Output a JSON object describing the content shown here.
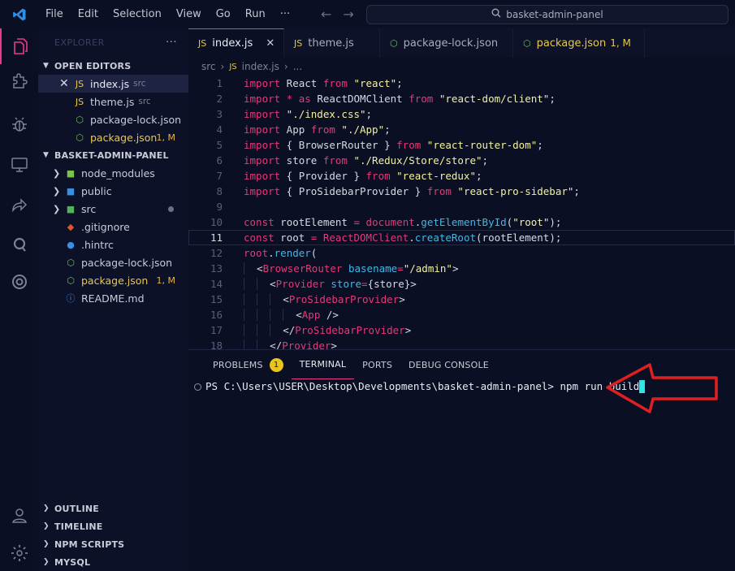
{
  "titlebar": {
    "menu": [
      "File",
      "Edit",
      "Selection",
      "View",
      "Go",
      "Run",
      "···"
    ],
    "search_text": "basket-admin-panel"
  },
  "sidebar": {
    "title": "EXPLORER",
    "more": "···",
    "open_editors_label": "OPEN EDITORS",
    "open_editors": [
      {
        "name": "index.js",
        "sub": "src",
        "icon": "js-icon",
        "active": true
      },
      {
        "name": "theme.js",
        "sub": "src",
        "icon": "js-icon"
      },
      {
        "name": "package-lock.json",
        "sub": "",
        "icon": "npm-icon"
      },
      {
        "name": "package.json",
        "sub": "",
        "mod": "1, M",
        "icon": "npm-icon"
      }
    ],
    "project_label": "BASKET-ADMIN-PANEL",
    "tree": [
      {
        "name": "node_modules",
        "type": "folder"
      },
      {
        "name": "public",
        "type": "folder"
      },
      {
        "name": "src",
        "type": "folder"
      },
      {
        "name": ".gitignore",
        "type": "file"
      },
      {
        "name": ".hintrc",
        "type": "file"
      },
      {
        "name": "package-lock.json",
        "type": "file"
      },
      {
        "name": "package.json",
        "type": "file",
        "mod": "1, M"
      },
      {
        "name": "README.md",
        "type": "file"
      }
    ],
    "bottom_sections": [
      "OUTLINE",
      "TIMELINE",
      "NPM SCRIPTS",
      "MYSQL"
    ]
  },
  "editor": {
    "tabs": [
      {
        "label": "index.js",
        "close": "✕"
      },
      {
        "label": "theme.js"
      },
      {
        "label": "package-lock.json"
      },
      {
        "label": "package.json",
        "mod": "1, M"
      }
    ],
    "breadcrumb": [
      "src",
      "›",
      "index.js",
      "›",
      "..."
    ],
    "line_numbers": [
      "1",
      "2",
      "3",
      "4",
      "5",
      "6",
      "7",
      "8",
      "9",
      "10",
      "11",
      "12",
      "13",
      "14",
      "15",
      "16",
      "17",
      "18"
    ],
    "current_line": 11
  },
  "panel": {
    "tabs": [
      "PROBLEMS",
      "TERMINAL",
      "PORTS",
      "DEBUG CONSOLE"
    ],
    "problems_count": "1",
    "prompt": "PS C:\\Users\\USER\\Desktop\\Developments\\basket-admin-panel>",
    "command": "npm run build"
  },
  "colors": {
    "accent": "#e83a8a",
    "keyword": "#e5397a",
    "string": "#f2f2a0",
    "attribute": "#40b8e6",
    "cursor": "#2ee6e6",
    "arrow": "#e02020"
  }
}
